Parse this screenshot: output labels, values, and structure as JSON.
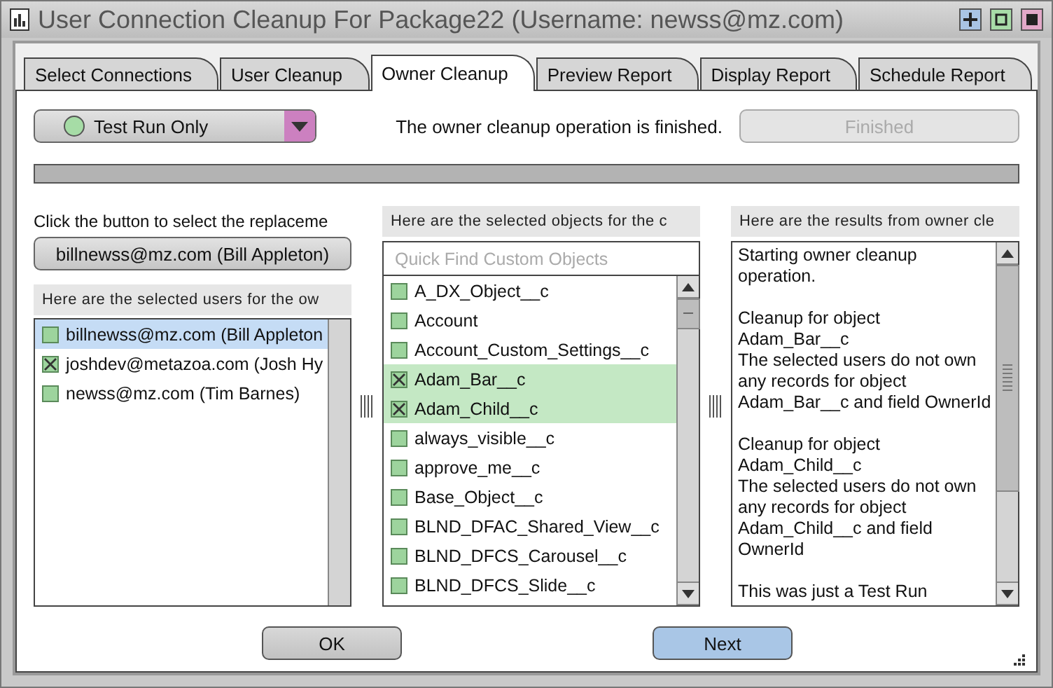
{
  "window": {
    "title": "User Connection Cleanup For Package22 (Username: newss@mz.com)"
  },
  "tabs": [
    {
      "label": "Select Connections",
      "selected": false
    },
    {
      "label": "User Cleanup",
      "selected": false
    },
    {
      "label": "Owner Cleanup",
      "selected": true
    },
    {
      "label": "Preview Report",
      "selected": false
    },
    {
      "label": "Display Report",
      "selected": false
    },
    {
      "label": "Schedule Report",
      "selected": false
    }
  ],
  "mode_dropdown": {
    "value": "Test Run Only"
  },
  "status_message": "The owner cleanup operation is finished.",
  "finished_button": {
    "label": "Finished",
    "disabled": true
  },
  "progress": {
    "level": 1
  },
  "replacement": {
    "instruction": "Click the button to select the replaceme",
    "button": "billnewss@mz.com (Bill Appleton)"
  },
  "users": {
    "header": "Here are the selected users for the ow",
    "items": [
      {
        "label": "billnewss@mz.com (Bill Appleton",
        "checked": false,
        "selected": true
      },
      {
        "label": "joshdev@metazoa.com (Josh Hy",
        "checked": true,
        "selected": false
      },
      {
        "label": "newss@mz.com (Tim Barnes)",
        "checked": false,
        "selected": false
      }
    ]
  },
  "objects": {
    "header": "Here are the selected objects for the c",
    "search": {
      "placeholder": "Quick Find Custom Objects"
    },
    "items": [
      {
        "label": "A_DX_Object__c",
        "checked": false,
        "selected": false
      },
      {
        "label": "Account",
        "checked": false,
        "selected": false
      },
      {
        "label": "Account_Custom_Settings__c",
        "checked": false,
        "selected": false
      },
      {
        "label": "Adam_Bar__c",
        "checked": true,
        "selected": true
      },
      {
        "label": "Adam_Child__c",
        "checked": true,
        "selected": true
      },
      {
        "label": "always_visible__c",
        "checked": false,
        "selected": false
      },
      {
        "label": "approve_me__c",
        "checked": false,
        "selected": false
      },
      {
        "label": "Base_Object__c",
        "checked": false,
        "selected": false
      },
      {
        "label": "BLND_DFAC_Shared_View__c",
        "checked": false,
        "selected": false
      },
      {
        "label": "BLND_DFCS_Carousel__c",
        "checked": false,
        "selected": false
      },
      {
        "label": "BLND_DFCS_Slide__c",
        "checked": false,
        "selected": false
      }
    ]
  },
  "results": {
    "header": "Here are the results from owner cle",
    "paragraphs": [
      [
        "Starting owner cleanup",
        "operation."
      ],
      [
        "Cleanup for object",
        "Adam_Bar__c",
        "The selected users do not own",
        "any records for object",
        "Adam_Bar__c and field OwnerId"
      ],
      [
        "Cleanup for object",
        "Adam_Child__c",
        "The selected users do not own",
        "any records for object",
        "Adam_Child__c and field",
        "OwnerId"
      ],
      [
        "This was just a Test Run"
      ]
    ]
  },
  "buttons": [
    {
      "label": "OK",
      "default": false
    },
    {
      "label": "Next",
      "default": true
    }
  ]
}
